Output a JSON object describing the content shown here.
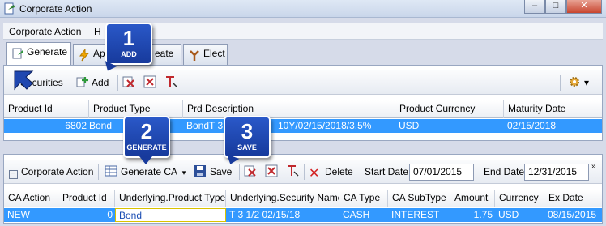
{
  "window": {
    "title": "Corporate Action",
    "buttons": {
      "minimize": "–",
      "maximize": "□",
      "close": "✕"
    }
  },
  "menu": {
    "items": [
      "Corporate Action",
      "H"
    ]
  },
  "tabs": [
    {
      "label": "Generate",
      "icon": "generate-icon"
    },
    {
      "label": "Ap",
      "icon": "lightning-icon"
    },
    {
      "label": "eate",
      "icon": "create-icon"
    },
    {
      "label": "Elect",
      "icon": "elect-icon"
    }
  ],
  "top_toolbar": {
    "securities_label": "Securities",
    "add_label": "Add"
  },
  "securities_grid": {
    "columns": [
      "Product Id",
      "Product Type",
      "Prd Description",
      "Product Currency",
      "Maturity Date"
    ],
    "rows": [
      {
        "product_id": "6802",
        "product_type": "Bond",
        "prd_description": "BondT 3 1",
        "prd_description_tail": "10Y/02/15/2018/3.5%",
        "product_currency": "USD",
        "maturity_date": "02/15/2018"
      }
    ]
  },
  "bottom_toolbar": {
    "corporate_action_label": "Corporate Action",
    "generate_ca_label": "Generate CA",
    "save_label": "Save",
    "delete_label": "Delete",
    "start_date_label": "Start Date",
    "start_date_value": "07/01/2015",
    "end_date_label": "End Date",
    "end_date_value": "12/31/2015"
  },
  "ca_grid": {
    "columns": [
      "CA Action",
      "Product Id",
      "Underlying.Product Type",
      "Underlying.Security Name",
      "CA Type",
      "CA SubType",
      "Amount",
      "Currency",
      "Ex Date"
    ],
    "rows": [
      {
        "ca_action": "NEW",
        "product_id": "0",
        "product_type": "Bond",
        "security_name": "T 3 1/2 02/15/18",
        "ca_type": "CASH",
        "ca_subtype": "INTEREST",
        "amount": "1.75",
        "currency": "USD",
        "ex_date": "08/15/2015"
      }
    ]
  },
  "callouts": [
    {
      "number": "1",
      "label": "ADD"
    },
    {
      "number": "2",
      "label": "GENERATE"
    },
    {
      "number": "3",
      "label": "SAVE"
    }
  ],
  "colors": {
    "selection": "#3399ff",
    "callout": "#1f47b0",
    "delete": "#d32222"
  }
}
